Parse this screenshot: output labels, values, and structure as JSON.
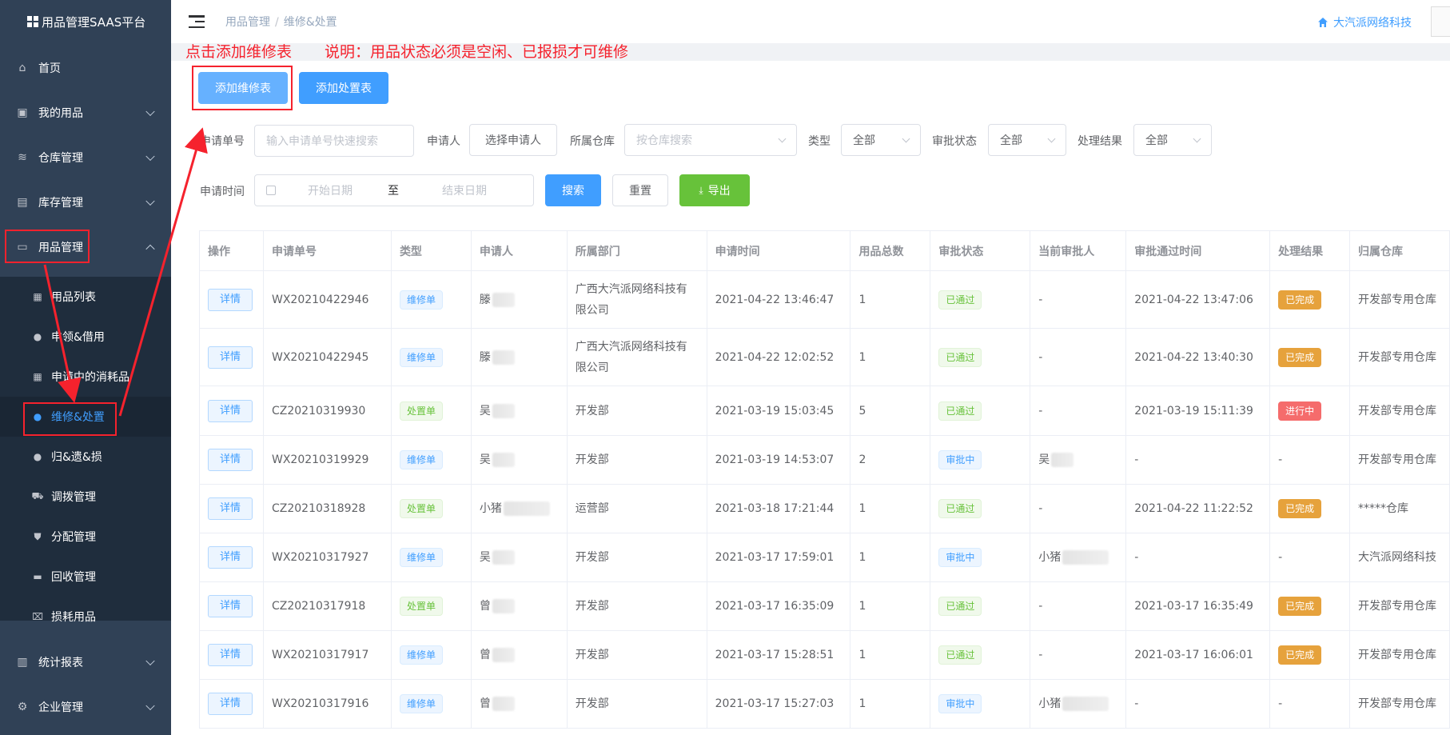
{
  "app": {
    "title": "用品管理SAAS平台"
  },
  "sidebar": {
    "items": [
      {
        "label": "首页",
        "icon": "home-icon"
      },
      {
        "label": "我的用品",
        "icon": "bag-icon"
      },
      {
        "label": "仓库管理",
        "icon": "database-icon"
      },
      {
        "label": "库存管理",
        "icon": "box-icon"
      },
      {
        "label": "用品管理",
        "icon": "inbox-icon"
      },
      {
        "label": "统计报表",
        "icon": "bar-chart-icon"
      },
      {
        "label": "企业管理",
        "icon": "gear-icon"
      }
    ],
    "sub_items": [
      {
        "label": "用品列表",
        "icon": "clipboard-icon"
      },
      {
        "label": "申领&借用",
        "icon": "user-icon"
      },
      {
        "label": "申请中的消耗品",
        "icon": "clipboard-icon"
      },
      {
        "label": "维修&处置",
        "icon": "user-icon"
      },
      {
        "label": "归&遗&损",
        "icon": "user-icon"
      },
      {
        "label": "调拨管理",
        "icon": "truck-icon"
      },
      {
        "label": "分配管理",
        "icon": "cart-icon"
      },
      {
        "label": "回收管理",
        "icon": "printer-icon"
      },
      {
        "label": "损耗用品",
        "icon": "trash-icon"
      }
    ]
  },
  "header": {
    "breadcrumb": [
      "用品管理",
      "维修&处置"
    ],
    "separator": "/",
    "company": "大汽派网络科技"
  },
  "annotations": {
    "click_hint": "点击添加维修表",
    "note": "说明：用品状态必须是空闲、已报损才可维修"
  },
  "toolbar": {
    "add_repair": "添加维修表",
    "add_dispose": "添加处置表"
  },
  "filters": {
    "order_no_label": "申请单号",
    "order_no_placeholder": "输入申请单号快速搜索",
    "applicant_label": "申请人",
    "applicant_button": "选择申请人",
    "warehouse_label": "所属仓库",
    "warehouse_placeholder": "按仓库搜索",
    "type_label": "类型",
    "type_value": "全部",
    "approval_label": "审批状态",
    "approval_value": "全部",
    "result_label": "处理结果",
    "result_value": "全部",
    "time_label": "申请时间",
    "start_placeholder": "开始日期",
    "range_sep": "至",
    "end_placeholder": "结束日期",
    "search": "搜索",
    "reset": "重置",
    "export": "导出"
  },
  "table": {
    "columns": [
      "操作",
      "申请单号",
      "类型",
      "申请人",
      "所属部门",
      "申请时间",
      "用品总数",
      "审批状态",
      "当前审批人",
      "审批通过时间",
      "处理结果",
      "归属仓库"
    ],
    "detail_label": "详情",
    "rows": [
      {
        "no": "WX20210422946",
        "type": "维修单",
        "type_color": "blue",
        "applicant": "滕",
        "dept": "广西大汽派网络科技有限公司",
        "time": "2021-04-22 13:46:47",
        "count": "1",
        "status": "已通过",
        "status_color": "green",
        "approver": "-",
        "approved_at": "2021-04-22 13:47:06",
        "result": "已完成",
        "result_color": "orange",
        "warehouse": "开发部专用仓库"
      },
      {
        "no": "WX20210422945",
        "type": "维修单",
        "type_color": "blue",
        "applicant": "滕",
        "dept": "广西大汽派网络科技有限公司",
        "time": "2021-04-22 12:02:52",
        "count": "1",
        "status": "已通过",
        "status_color": "green",
        "approver": "-",
        "approved_at": "2021-04-22 13:40:30",
        "result": "已完成",
        "result_color": "orange",
        "warehouse": "开发部专用仓库"
      },
      {
        "no": "CZ20210319930",
        "type": "处置单",
        "type_color": "green",
        "applicant": "吴",
        "dept": "开发部",
        "time": "2021-03-19 15:03:45",
        "count": "5",
        "status": "已通过",
        "status_color": "green",
        "approver": "-",
        "approved_at": "2021-03-19 15:11:39",
        "result": "进行中",
        "result_color": "red",
        "warehouse": "开发部专用仓库"
      },
      {
        "no": "WX20210319929",
        "type": "维修单",
        "type_color": "blue",
        "applicant": "吴",
        "dept": "开发部",
        "time": "2021-03-19 14:53:07",
        "count": "2",
        "status": "审批中",
        "status_color": "blue",
        "approver": "吴",
        "approved_at": "-",
        "result": "-",
        "result_color": "",
        "warehouse": "开发部专用仓库"
      },
      {
        "no": "CZ20210318928",
        "type": "处置单",
        "type_color": "green",
        "applicant": "小猪",
        "dept": "运营部",
        "time": "2021-03-18 17:21:44",
        "count": "1",
        "status": "已通过",
        "status_color": "green",
        "approver": "-",
        "approved_at": "2021-04-22 11:22:52",
        "result": "已完成",
        "result_color": "orange",
        "warehouse": "*****仓库"
      },
      {
        "no": "WX20210317927",
        "type": "维修单",
        "type_color": "blue",
        "applicant": "吴",
        "dept": "开发部",
        "time": "2021-03-17 17:59:01",
        "count": "1",
        "status": "审批中",
        "status_color": "blue",
        "approver": "小猪",
        "approved_at": "-",
        "result": "-",
        "result_color": "",
        "warehouse": "大汽派网络科技"
      },
      {
        "no": "CZ20210317918",
        "type": "处置单",
        "type_color": "green",
        "applicant": "曾",
        "dept": "开发部",
        "time": "2021-03-17 16:35:09",
        "count": "1",
        "status": "已通过",
        "status_color": "green",
        "approver": "-",
        "approved_at": "2021-03-17 16:35:49",
        "result": "已完成",
        "result_color": "orange",
        "warehouse": "开发部专用仓库"
      },
      {
        "no": "WX20210317917",
        "type": "维修单",
        "type_color": "blue",
        "applicant": "曾",
        "dept": "开发部",
        "time": "2021-03-17 15:28:51",
        "count": "1",
        "status": "已通过",
        "status_color": "green",
        "approver": "-",
        "approved_at": "2021-03-17 16:06:01",
        "result": "已完成",
        "result_color": "orange",
        "warehouse": "开发部专用仓库"
      },
      {
        "no": "WX20210317916",
        "type": "维修单",
        "type_color": "blue",
        "applicant": "曾",
        "dept": "开发部",
        "time": "2021-03-17 15:27:03",
        "count": "1",
        "status": "审批中",
        "status_color": "blue",
        "approver": "小猪",
        "approved_at": "-",
        "result": "-",
        "result_color": "",
        "warehouse": "开发部专用仓库"
      }
    ]
  }
}
